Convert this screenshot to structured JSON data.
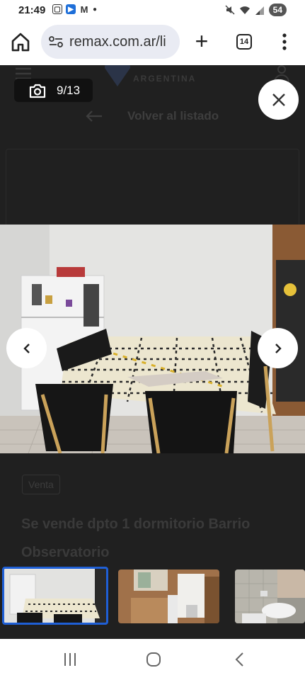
{
  "status_bar": {
    "time": "21:49",
    "battery": "54",
    "left_icons": [
      "screenshot-icon",
      "app-icon",
      "gmail-icon",
      "dot-icon"
    ],
    "right_icons": [
      "mute-icon",
      "wifi-icon",
      "signal-icon"
    ]
  },
  "browser": {
    "url": "remax.com.ar/li",
    "tab_count": "14",
    "icons": [
      "home-icon",
      "site-info-icon",
      "new-tab-icon",
      "menu-icon"
    ]
  },
  "page": {
    "logo_text": "ARGENTINA",
    "back_link": "Volver al listado",
    "tag": "Venta",
    "title": "Se vende dpto 1 dormitorio Barrio Observatorio"
  },
  "gallery": {
    "counter": "9/13",
    "current_index": 9,
    "total": 13
  },
  "colors": {
    "overlay": "#1b1b1b",
    "active_thumb_border": "#1f5fd6",
    "chrome_url_bg": "#e9ebf3"
  }
}
